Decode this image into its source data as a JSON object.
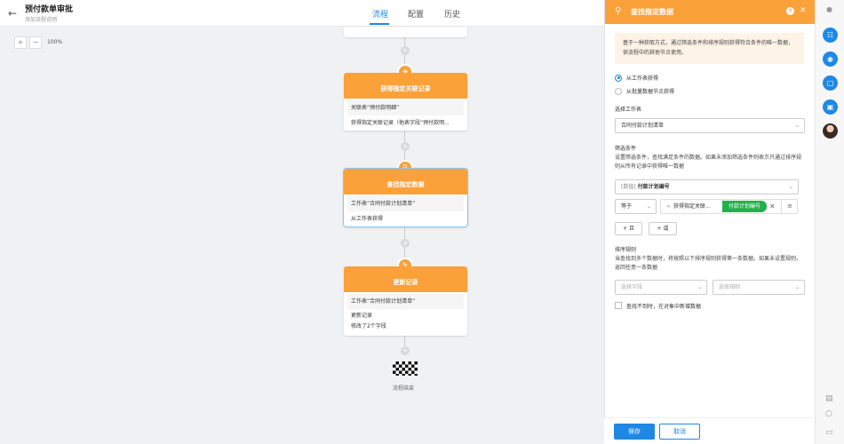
{
  "header": {
    "back_icon": "arrow-left-icon",
    "title": "预付款单审批",
    "subtitle": "添加流程说明",
    "tabs": [
      {
        "label": "流程",
        "active": true
      },
      {
        "label": "配置",
        "active": false
      },
      {
        "label": "历史",
        "active": false
      }
    ]
  },
  "zoom": {
    "plus": "+",
    "minus": "−",
    "level": "100%"
  },
  "flow": {
    "nodes": [
      {
        "title": "获得指定关联记录",
        "rows": [
          "关联表“预付款明细”",
          "获得指定关联记录（他表字段“预付款明..."
        ]
      },
      {
        "title": "查找指定数据",
        "rows": [
          "工作表“合同付款计划清单”",
          "从工作表获得"
        ]
      },
      {
        "title": "更新记录",
        "rows": [
          "工作表“合同付款计划清单”",
          "更新记录",
          "修改了2个字段"
        ]
      }
    ],
    "end_label": "流程结束"
  },
  "panel": {
    "title": "查找指定数据",
    "description": "基于一种获取方式，通过筛选条件和排序规则获得符合条件的唯一数据，供流程中的其他节点使用。",
    "radio_options": [
      "从工作表获得",
      "从批量数据节点获得"
    ],
    "sheet_label": "选择工作表",
    "sheet_value": "合同付款计划清单",
    "filter_label": "筛选条件",
    "filter_hint": "设置筛选条件，查找满足条件的数据。如果未添加筛选条件则表示只通过排序规则从所有记录中获得唯一数据",
    "field_prefix": "[数值]",
    "field_value": "付款计划编号",
    "operator": "等于",
    "tag_source": "获得指定关联...",
    "tag_field": "付款计划编号",
    "and_button": "+ 且",
    "or_button": "+ 或",
    "sort_label": "排序规则",
    "sort_hint": "当查找到多个数据时，将按照以下排序规则获得第一条数据。如果未设置规则，返回任意一条数据",
    "sort_field_placeholder": "选择字段",
    "sort_rule_placeholder": "选择规则",
    "checkbox_label": "查找不到时，在对象中新增数据",
    "save": "保存",
    "cancel": "取消"
  },
  "colors": {
    "accent": "#1e88e5",
    "node_orange": "#fba13a",
    "tag_green": "#22b14c"
  }
}
